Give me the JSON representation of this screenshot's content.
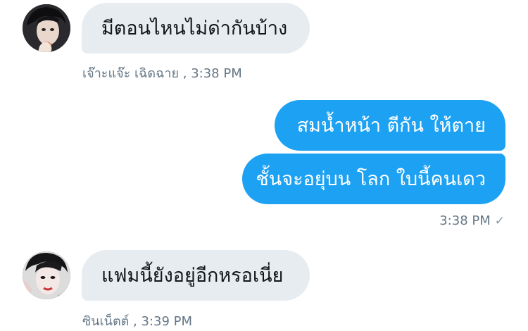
{
  "conversation": {
    "messages": [
      {
        "direction": "incoming",
        "text": "มีตอนไหนไม่ด่ากันบ้าง",
        "sender": "เจ๊าะแจ๊ะ เฉิดฉาย",
        "time": " , 3:38 PM"
      },
      {
        "direction": "outgoing",
        "text": "สมน้ำหน้า ตีกัน ให้ตาย"
      },
      {
        "direction": "outgoing",
        "text": "ชั้นจะอยุ่บน โลก ใบนี้คนเดว",
        "time": "3:38 PM",
        "status_icon": "✓"
      },
      {
        "direction": "incoming",
        "text": "แฟมนี้ยังอยู่อีกหรอเนี่ย",
        "sender": "ซินเน็ตต์",
        "time": " , 3:39 PM"
      }
    ]
  },
  "colors": {
    "outgoing_bubble": "#1da1f2",
    "incoming_bubble": "#e6ecf0",
    "meta_text": "#657786"
  },
  "icons": {
    "avatar_1": "user-avatar-photo",
    "avatar_2": "user-avatar-photo",
    "read_status": "checkmark-icon"
  }
}
